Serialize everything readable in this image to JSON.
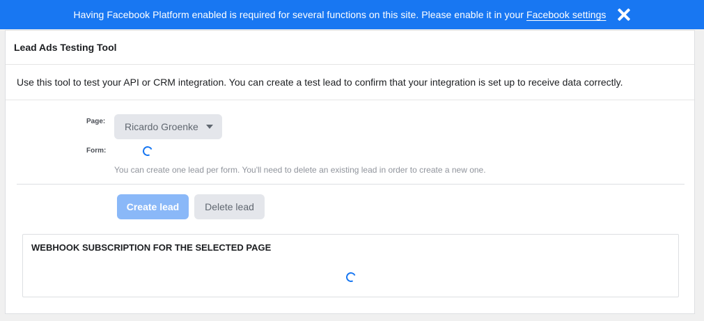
{
  "banner": {
    "message": "Having Facebook Platform enabled is required for several functions on this site. Please enable it in your",
    "link_label": "Facebook settings",
    "close_icon": "close-icon",
    "background": "#1877f2"
  },
  "tool": {
    "title": "Lead Ads Testing Tool",
    "description": "Use this tool to test your API or CRM integration. You can create a test lead to confirm that your integration is set up to receive data correctly."
  },
  "form": {
    "page_label": "Page:",
    "page_selected": "Ricardo Groenke",
    "form_label": "Form:",
    "hint": "You can create one lead per form. You'll need to delete an existing lead in order to create a new one."
  },
  "actions": {
    "create_label": "Create lead",
    "delete_label": "Delete lead"
  },
  "webhook": {
    "title": "WEBHOOK SUBSCRIPTION FOR THE SELECTED PAGE"
  },
  "icons": {
    "dropdown": "chevron-down-icon",
    "loading": "spinner-icon"
  }
}
